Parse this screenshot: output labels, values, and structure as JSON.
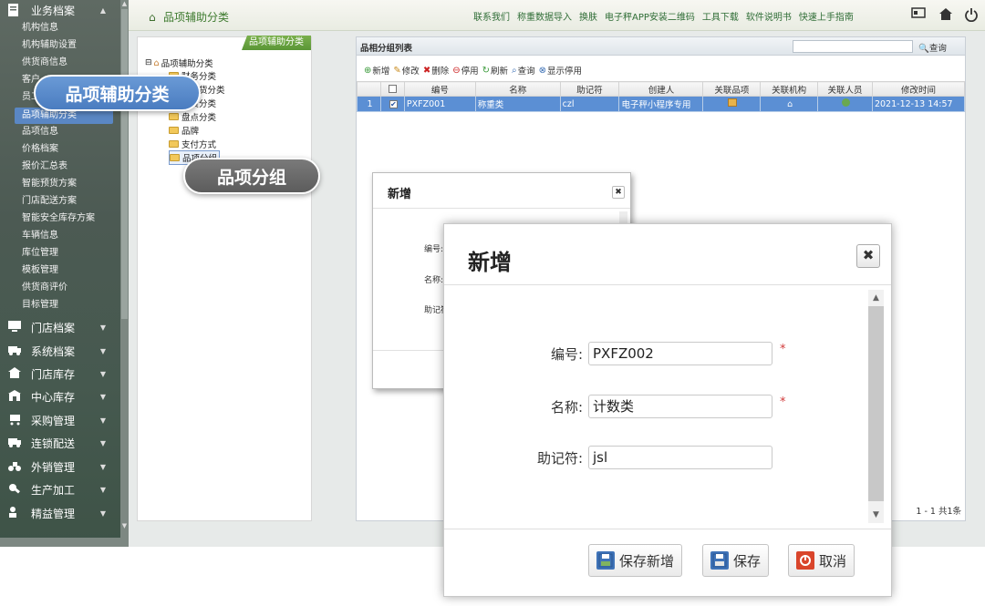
{
  "sidebar": {
    "top_section": "业务档案",
    "items": [
      "机构信息",
      "机构辅助设置",
      "供货商信息",
      "客户",
      "员工",
      "品项辅助分类",
      "品项信息",
      "价格档案",
      "报价汇总表",
      "智能预货方案",
      "门店配送方案",
      "智能安全库存方案",
      "车辆信息",
      "库位管理",
      "模板管理",
      "供货商评价",
      "目标管理"
    ],
    "active_item": "品项辅助分类",
    "sections": [
      "门店档案",
      "系统档案",
      "门店库存",
      "中心库存",
      "采购管理",
      "连锁配送",
      "外销管理",
      "生产加工",
      "精益管理"
    ]
  },
  "topbar": {
    "title": "品项辅助分类",
    "links": [
      "联系我们",
      "称重数据导入",
      "换肤",
      "电子秤APP安装二维码",
      "工具下载",
      "软件说明书",
      "快速上手指南"
    ]
  },
  "tree": {
    "tab": "品项辅助分类",
    "root": "品项辅助分类",
    "nodes": [
      "财务分类",
      "配送货分类",
      "订货分类",
      "盘点分类",
      "品牌",
      "支付方式",
      "品项分组"
    ]
  },
  "grid": {
    "title": "品相分组列表",
    "search_label": "查询",
    "search_value": "",
    "toolbar": [
      "新增",
      "修改",
      "删除",
      "停用",
      "刷新",
      "查询",
      "显示停用"
    ],
    "columns": [
      "",
      "编号",
      "名称",
      "助记符",
      "创建人",
      "关联品项",
      "关联机构",
      "关联人员",
      "修改时间"
    ],
    "rows": [
      {
        "num": "1",
        "code": "PXFZ001",
        "name": "称重类",
        "mnemonic": "czl",
        "creator": "电子秤小程序专用",
        "modified": "2021-12-13 14:57"
      }
    ],
    "pager": "1 - 1  共1条"
  },
  "dialog_small": {
    "title": "新增",
    "close": "✖",
    "labels": [
      "编号:",
      "名称:",
      "助记符"
    ]
  },
  "callouts": {
    "aux": "品项辅助分类",
    "group": "品项分组"
  },
  "dialog": {
    "title": "新增",
    "close": "✖",
    "fields": [
      {
        "label": "编号:",
        "value": "PXFZ002",
        "required": "*"
      },
      {
        "label": "名称:",
        "value": "计数类",
        "required": "*"
      },
      {
        "label": "助记符:",
        "value": "jsl",
        "required": ""
      }
    ],
    "buttons": [
      "保存新增",
      "保存",
      "取消"
    ]
  },
  "colors": {
    "accent": "#3d7a2e",
    "selection": "#5b8fd4",
    "callout": "#5b8fd4",
    "callout2": "#6b6b6b"
  }
}
